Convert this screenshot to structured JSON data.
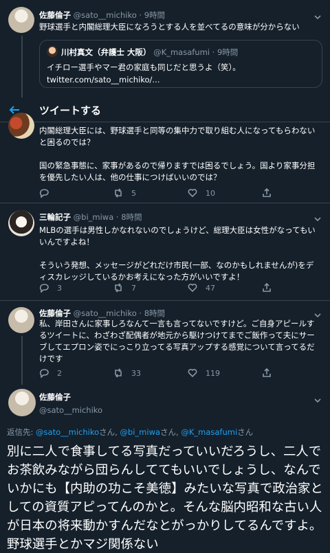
{
  "header": {
    "title": "ツイートする"
  },
  "tweets": [
    {
      "name": "佐藤倫子",
      "handle": "@sato__michiko",
      "time": "· 9時間",
      "text": "野球選手と内閣総理大臣になろうとする人を並べてるの意味が分からない",
      "quote": {
        "name": "川村真文（弁護士 大阪）",
        "handle": "@K_masafumi",
        "time": "· 9時間",
        "text": "イチロー選手やマー君の家庭も同じだと思うよ（笑）。\ntwitter.com/sato__michiko/..."
      }
    },
    {
      "text": "内閣総理大臣には、野球選手と同等の集中力で取り組む人になってもらわないと困るのでは？\n\n国の緊急事態に、家事があるので帰りますでは困るでしょう。国より家事分担を優先したい人は、他の仕事につけばいいのでは？",
      "retweets": "5",
      "likes": "10"
    },
    {
      "name": "三輪記子",
      "handle": "@bi_miwa",
      "time": "· 8時間",
      "text": "MLBの選手は男性しかなれないのでしょうけど、総理大臣は女性がなってもいいんですよね！\n\nそういう発想、メッセージがどれだけ市民(一部、なのかもしれませんが)をディスカレッジしているかお考えになった方がいいですよ！",
      "replies": "3",
      "retweets": "7",
      "likes": "47"
    },
    {
      "name": "佐藤倫子",
      "handle": "@sato__michiko",
      "time": "· 8時間",
      "text": "私、岸田さんに家事しろなんて一言も言ってないですけど。ご自身アピールするツイートに、わざわざ配偶者が地元から駆けつけてまでご飯作って夫にサーブしてエプロン姿でにっこり立ってる写真アップする感覚について言ってるだけです",
      "replies": "2",
      "retweets": "33",
      "likes": "119"
    }
  ],
  "main_tweet": {
    "name": "佐藤倫子",
    "handle": "@sato__michiko",
    "reply_prefix": "返信先: ",
    "reply_to": [
      "@sato__michiko",
      "@bi_miwa",
      "@K_masafumi"
    ],
    "reply_sep": "さん, ",
    "reply_suffix": "さん",
    "text": "別に二人で食事してる写真だっていいだろうし、二人でお茶飲みながら団らんしててもいいでしょうし、なんでいかにも【内助の功こそ美徳】みたいな写真で政治家としての資質アピってんのかと。そんな脳内昭和な古い人が日本の将来動かすんだなとがっかりしてるんですよ。野球選手とかマジ関係ない"
  }
}
